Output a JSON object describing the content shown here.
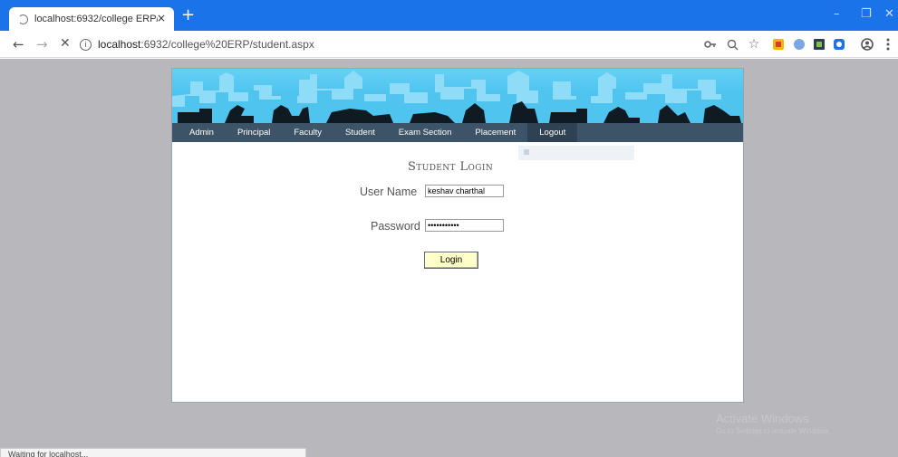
{
  "browser": {
    "tab_title": "localhost:6932/college ERP/stud",
    "tab_close": "×",
    "new_tab": "+",
    "url_host": "localhost",
    "url_rest": ":6932/college%20ERP/student.aspx",
    "info": "i",
    "window_controls": [
      "–",
      "❐",
      "✕"
    ],
    "toolbar_icons": [
      "key-icon",
      "zoom-icon",
      "star-icon",
      "extension-icon",
      "globe-icon",
      "extension-dark-icon",
      "extension-blue-icon",
      "account-icon",
      "menu-icon"
    ],
    "back": "←",
    "forward": "→",
    "stop": "✕"
  },
  "menu": [
    "Admin",
    "Principal",
    "Faculty",
    "Student",
    "Exam Section",
    "Placement",
    "Logout"
  ],
  "login": {
    "title": "Student Login",
    "username_label": "User Name",
    "username_value": "keshav charthal",
    "password_label": "Password",
    "password_value": "•••••••••••",
    "button": "Login"
  },
  "status_text": "Waiting for localhost...",
  "watermark": {
    "line1": "Activate Windows",
    "line2": "Go to Settings to activate Windows."
  },
  "colors": {
    "chrome_blue": "#1a73e8",
    "menubar": "#3d5468",
    "banner_sky": "#2fb6e8",
    "button_bg": "#ffffc8"
  }
}
